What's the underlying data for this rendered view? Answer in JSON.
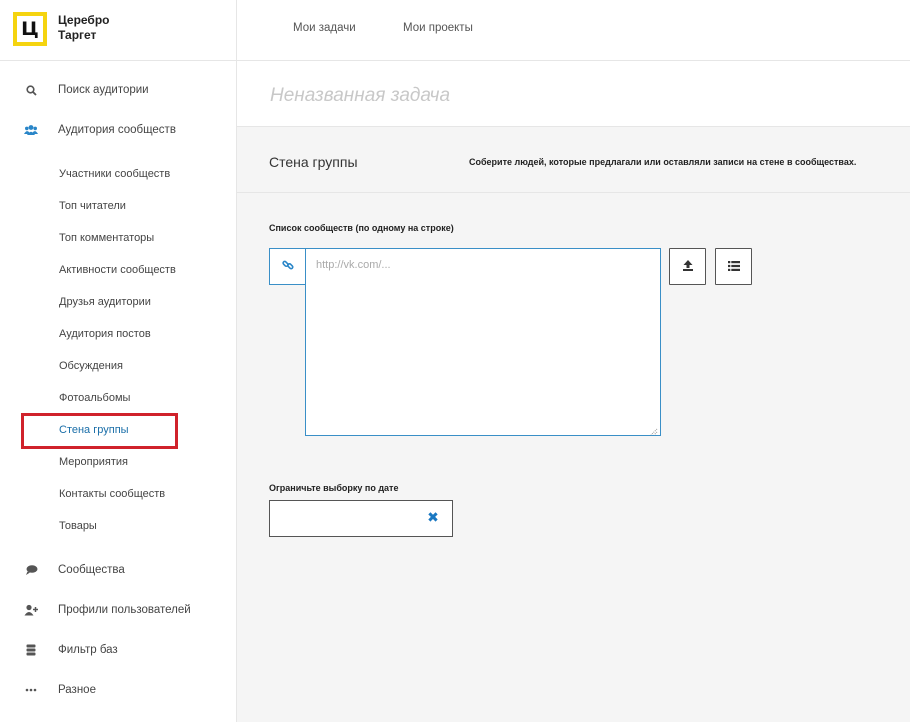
{
  "logo": {
    "mark": "Ц",
    "line1": "Церебро",
    "line2": "Таргет",
    "accent_color": "#f5d40f"
  },
  "header": {
    "tabs": [
      {
        "label": "Мои задачи"
      },
      {
        "label": "Мои проекты"
      }
    ]
  },
  "sidebar": {
    "top_items": [
      {
        "label": "Поиск аудитории",
        "icon": "search-icon"
      },
      {
        "label": "Аудитория сообществ",
        "icon": "users-icon"
      }
    ],
    "sub_items": [
      {
        "label": "Участники сообществ"
      },
      {
        "label": "Топ читатели"
      },
      {
        "label": "Топ комментаторы"
      },
      {
        "label": "Активности сообществ"
      },
      {
        "label": "Друзья аудитории"
      },
      {
        "label": "Аудитория постов"
      },
      {
        "label": "Обсуждения"
      },
      {
        "label": "Фотоальбомы"
      },
      {
        "label": "Стена группы",
        "active": true
      },
      {
        "label": "Мероприятия"
      },
      {
        "label": "Контакты сообществ"
      },
      {
        "label": "Товары"
      }
    ],
    "bottom_items": [
      {
        "label": "Сообщества",
        "icon": "chat-icon"
      },
      {
        "label": "Профили пользователей",
        "icon": "add-user-icon"
      },
      {
        "label": "Фильтр баз",
        "icon": "database-icon"
      },
      {
        "label": "Разное",
        "icon": "more-icon"
      }
    ],
    "highlight_color": "#d0222b",
    "active_color": "#1a6ea8"
  },
  "task": {
    "title_placeholder": "Неназванная задача"
  },
  "section": {
    "title": "Стена группы",
    "description": "Соберите людей, которые предлагали или оставляли записи на стене в сообществах."
  },
  "form": {
    "communities_label": "Список сообществ (по одному на строке)",
    "communities_placeholder": "http://vk.com/...",
    "communities_value": "",
    "date_label": "Ограничьте выборку по дате",
    "date_value": "",
    "link_icon": "link-icon",
    "upload_icon": "upload-icon",
    "list_icon": "list-icon",
    "clear_icon": "close-icon",
    "accent_color": "#3a8fc7"
  }
}
